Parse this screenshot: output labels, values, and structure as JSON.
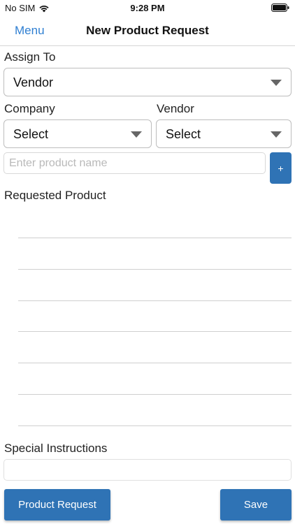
{
  "status_bar": {
    "carrier": "No SIM",
    "time": "9:28 PM"
  },
  "nav": {
    "menu_label": "Menu",
    "title": "New Product Request"
  },
  "form": {
    "assign_to": {
      "label": "Assign To",
      "value": "Vendor"
    },
    "company": {
      "label": "Company",
      "value": "Select"
    },
    "vendor": {
      "label": "Vendor",
      "value": "Select"
    },
    "product_name": {
      "placeholder": "Enter product name",
      "value": ""
    },
    "add_button_label": "+",
    "requested_product_label": "Requested Product",
    "special_instructions": {
      "label": "Special Instructions",
      "value": ""
    }
  },
  "actions": {
    "product_request_label": "Product Request",
    "save_label": "Save"
  },
  "colors": {
    "accent": "#2f7fd2",
    "button": "#2f73b5"
  },
  "icons": {
    "wifi": "wifi-icon",
    "battery": "battery-icon",
    "dropdown": "chevron-down-icon"
  }
}
